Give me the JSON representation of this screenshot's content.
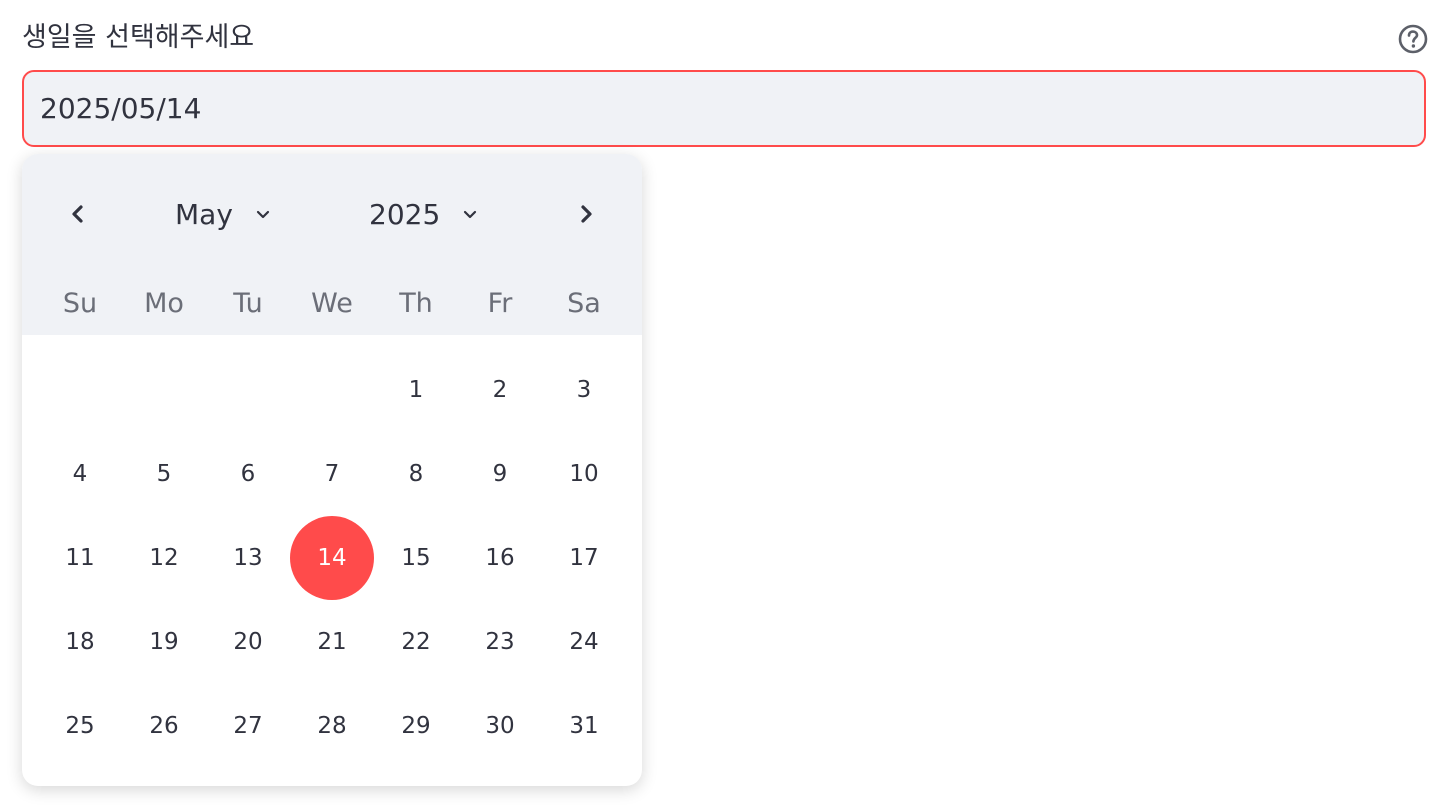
{
  "field": {
    "label": "생일을 선택해주세요",
    "value": "2025/05/14",
    "help_icon": "question-circle-icon",
    "accent_color": "#ff4b4b"
  },
  "calendar": {
    "prev_icon": "chevron-left-icon",
    "next_icon": "chevron-right-icon",
    "month": "May",
    "year": "2025",
    "weekdays": [
      "Su",
      "Mo",
      "Tu",
      "We",
      "Th",
      "Fr",
      "Sa"
    ],
    "leading_blanks": 4,
    "days": [
      "1",
      "2",
      "3",
      "4",
      "5",
      "6",
      "7",
      "8",
      "9",
      "10",
      "11",
      "12",
      "13",
      "14",
      "15",
      "16",
      "17",
      "18",
      "19",
      "20",
      "21",
      "22",
      "23",
      "24",
      "25",
      "26",
      "27",
      "28",
      "29",
      "30",
      "31"
    ],
    "selected_day": "14"
  }
}
